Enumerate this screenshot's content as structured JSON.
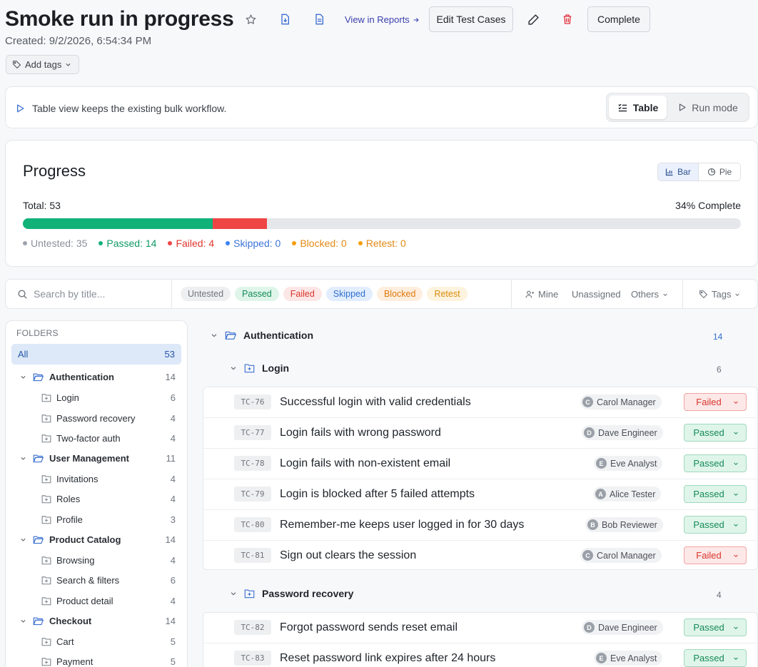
{
  "header": {
    "title": "Smoke run in progress",
    "created": "Created: 9/2/2026, 6:54:34 PM",
    "view_in_reports": "View in Reports",
    "edit_test_cases": "Edit Test Cases",
    "complete": "Complete",
    "add_tags": "Add tags"
  },
  "info": {
    "text": "Table view keeps the existing bulk workflow.",
    "view_table": "Table",
    "view_run_mode": "Run mode"
  },
  "progress": {
    "title": "Progress",
    "chart_bar": "Bar",
    "chart_pie": "Pie",
    "total": "Total: 53",
    "percent": "34% Complete",
    "fractions": {
      "passed": 0.264,
      "failed": 0.0755,
      "skipped": 0,
      "blocked": 0,
      "retest": 0
    },
    "colors": {
      "passed": "#10b27a",
      "failed": "#ef4444",
      "untested": "#9ca3af",
      "skipped": "#3b82f6",
      "blocked": "#f59e0b",
      "retest": "#f59e0b",
      "track": "#e5e7eb"
    },
    "legend": {
      "untested": "Untested: 35",
      "passed": "Passed: 14",
      "failed": "Failed: 4",
      "skipped": "Skipped: 0",
      "blocked": "Blocked: 0",
      "retest": "Retest: 0"
    }
  },
  "filters": {
    "search_placeholder": "Search by title...",
    "status_chips": [
      "Untested",
      "Passed",
      "Failed",
      "Skipped",
      "Blocked",
      "Retest"
    ],
    "mine": "Mine",
    "unassigned": "Unassigned",
    "others": "Others",
    "tags": "Tags"
  },
  "sidebar": {
    "heading": "FOLDERS",
    "all_label": "All",
    "all_count": "53",
    "items": [
      {
        "label": "Authentication",
        "count": "14"
      },
      {
        "label": "Login",
        "count": "6"
      },
      {
        "label": "Password recovery",
        "count": "4"
      },
      {
        "label": "Two-factor auth",
        "count": "4"
      },
      {
        "label": "User Management",
        "count": "11"
      },
      {
        "label": "Invitations",
        "count": "4"
      },
      {
        "label": "Roles",
        "count": "4"
      },
      {
        "label": "Profile",
        "count": "3"
      },
      {
        "label": "Product Catalog",
        "count": "14"
      },
      {
        "label": "Browsing",
        "count": "4"
      },
      {
        "label": "Search & filters",
        "count": "6"
      },
      {
        "label": "Product detail",
        "count": "4"
      },
      {
        "label": "Checkout",
        "count": "14"
      },
      {
        "label": "Cart",
        "count": "5"
      },
      {
        "label": "Payment",
        "count": "5"
      }
    ]
  },
  "main": {
    "group": {
      "label": "Authentication",
      "count": "14"
    },
    "subgroups": [
      {
        "label": "Login",
        "count": "6"
      },
      {
        "label": "Password recovery",
        "count": "4"
      }
    ],
    "cases": [
      {
        "id": "TC-76",
        "title": "Successful login with valid credentials",
        "avatar": "C",
        "assignee": "Carol Manager",
        "status": "Failed"
      },
      {
        "id": "TC-77",
        "title": "Login fails with wrong password",
        "avatar": "D",
        "assignee": "Dave Engineer",
        "status": "Passed"
      },
      {
        "id": "TC-78",
        "title": "Login fails with non-existent email",
        "avatar": "E",
        "assignee": "Eve Analyst",
        "status": "Passed"
      },
      {
        "id": "TC-79",
        "title": "Login is blocked after 5 failed attempts",
        "avatar": "A",
        "assignee": "Alice Tester",
        "status": "Passed"
      },
      {
        "id": "TC-80",
        "title": "Remember-me keeps user logged in for 30 days",
        "avatar": "B",
        "assignee": "Bob Reviewer",
        "status": "Passed"
      },
      {
        "id": "TC-81",
        "title": "Sign out clears the session",
        "avatar": "C",
        "assignee": "Carol Manager",
        "status": "Failed"
      },
      {
        "id": "TC-82",
        "title": "Forgot password sends reset email",
        "avatar": "D",
        "assignee": "Dave Engineer",
        "status": "Passed"
      },
      {
        "id": "TC-83",
        "title": "Reset password link expires after 24 hours",
        "avatar": "E",
        "assignee": "Eve Analyst",
        "status": "Passed"
      }
    ]
  }
}
